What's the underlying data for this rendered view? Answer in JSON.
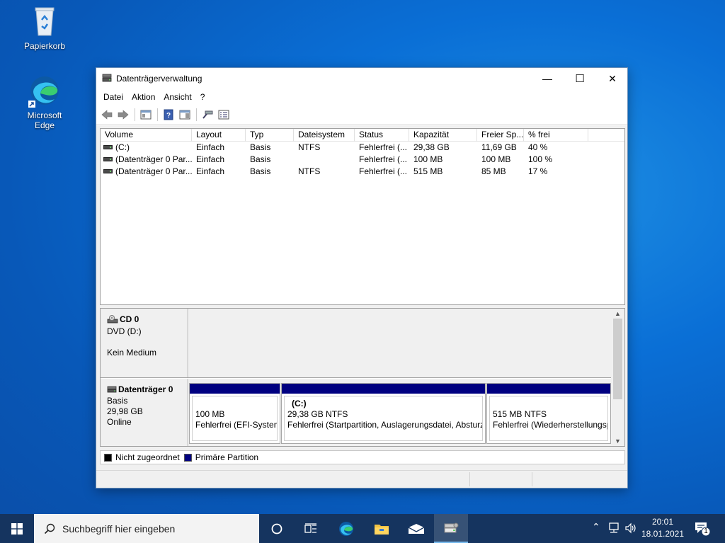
{
  "desktop": {
    "icons": [
      {
        "label": "Papierkorb"
      },
      {
        "label": "Microsoft Edge"
      }
    ]
  },
  "window": {
    "title": "Datenträgerverwaltung",
    "controls": {
      "minimize": "—",
      "maximize": "☐",
      "close": "✕"
    }
  },
  "menu": [
    "Datei",
    "Aktion",
    "Ansicht",
    "?"
  ],
  "table": {
    "columns": [
      "Volume",
      "Layout",
      "Typ",
      "Dateisystem",
      "Status",
      "Kapazität",
      "Freier Sp...",
      "% frei"
    ],
    "rows": [
      [
        "(C:)",
        "Einfach",
        "Basis",
        "NTFS",
        "Fehlerfrei (...",
        "29,38 GB",
        "11,69 GB",
        "40 %"
      ],
      [
        "(Datenträger 0 Par...",
        "Einfach",
        "Basis",
        "",
        "Fehlerfrei (...",
        "100 MB",
        "100 MB",
        "100 %"
      ],
      [
        "(Datenträger 0 Par...",
        "Einfach",
        "Basis",
        "NTFS",
        "Fehlerfrei (...",
        "515 MB",
        "85 MB",
        "17 %"
      ]
    ]
  },
  "disks": [
    {
      "name": "CD 0",
      "line2": "DVD (D:)",
      "line3": "",
      "line4": "Kein Medium"
    },
    {
      "name": "Datenträger 0",
      "line2": "Basis",
      "line3": "29,98 GB",
      "line4": "Online",
      "partitions": [
        {
          "title": "",
          "size": "100 MB",
          "status": "Fehlerfrei (EFI-System"
        },
        {
          "title": "(C:)",
          "size": "29,38 GB NTFS",
          "status": "Fehlerfrei (Startpartition, Auslagerungsdatei, Absturz"
        },
        {
          "title": "",
          "size": "515 MB NTFS",
          "status": "Fehlerfrei (Wiederherstellungsp"
        }
      ]
    }
  ],
  "legend": [
    {
      "label": "Nicht zugeordnet",
      "color": "#000000"
    },
    {
      "label": "Primäre Partition",
      "color": "#000080"
    }
  ],
  "taskbar": {
    "search_placeholder": "Suchbegriff hier eingeben",
    "time": "20:01",
    "date": "18.01.2021",
    "notification_count": "1"
  }
}
